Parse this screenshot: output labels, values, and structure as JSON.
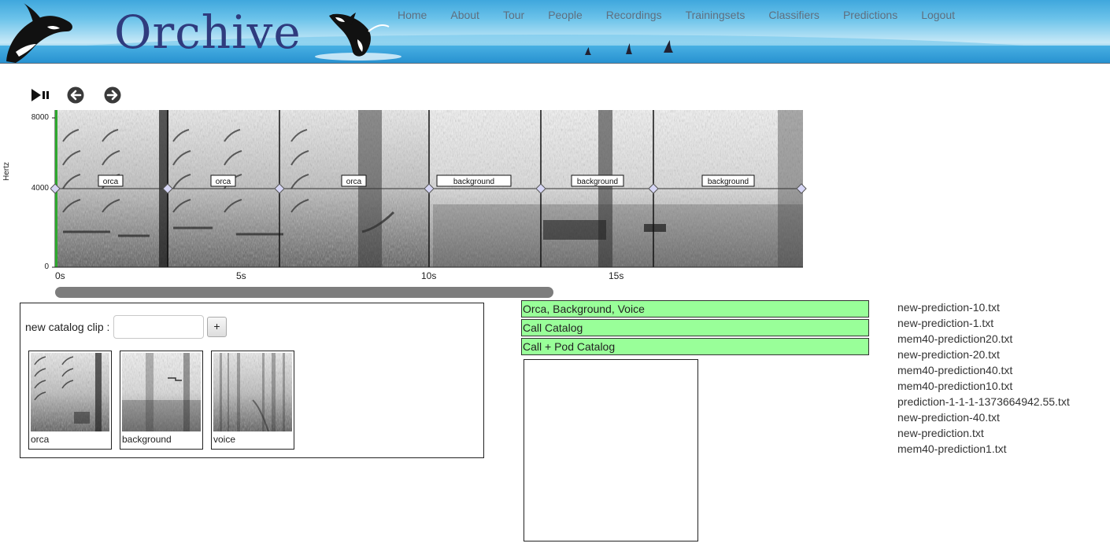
{
  "header": {
    "logo": "Orchive",
    "nav": [
      "Home",
      "About",
      "Tour",
      "People",
      "Recordings",
      "Trainingsets",
      "Classifiers",
      "Predictions",
      "Logout"
    ]
  },
  "player": {
    "controls": [
      "play-pause-icon",
      "prev-arrow-icon",
      "next-arrow-icon"
    ]
  },
  "spectrogram": {
    "y_label": "Hertz",
    "y_ticks": [
      "8000",
      "4000",
      "0"
    ],
    "x_ticks": [
      "0s",
      "5s",
      "10s",
      "15s"
    ],
    "segments": [
      "orca",
      "orca",
      "orca",
      "background",
      "background",
      "background"
    ],
    "scroll_fraction": 0.667
  },
  "catalog": {
    "label": "new catalog clip :",
    "input_value": "",
    "add_label": "+",
    "clips": [
      "orca",
      "background",
      "voice"
    ]
  },
  "classifiers": [
    "Orca, Background, Voice",
    "Call Catalog",
    "Call + Pod Catalog"
  ],
  "predictions": [
    "new-prediction-10.txt",
    "new-prediction-1.txt",
    "mem40-prediction20.txt",
    "new-prediction-20.txt",
    "mem40-prediction40.txt",
    "mem40-prediction10.txt",
    "prediction-1-1-1-1373664942.55.txt",
    "new-prediction-40.txt",
    "new-prediction.txt",
    "mem40-prediction1.txt"
  ],
  "colors": {
    "classifier_bg": "#99ff99",
    "logo": "#2f3b7e",
    "nav": "#5f6f7f",
    "scroll_thumb": "#7d7d7d"
  }
}
